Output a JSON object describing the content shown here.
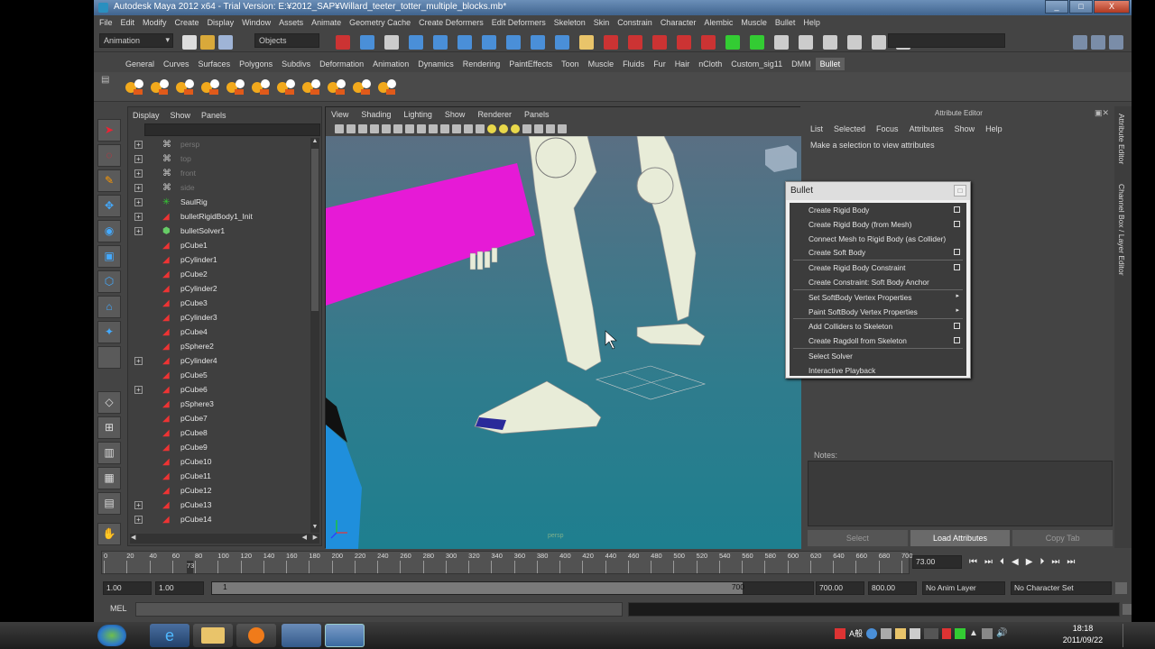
{
  "window": {
    "title": "Autodesk Maya 2012 x64 - Trial Version: E:¥2012_SAP¥Willard_teeter_totter_multiple_blocks.mb*",
    "controls": [
      "_",
      "□",
      "X"
    ]
  },
  "menubar": [
    "File",
    "Edit",
    "Modify",
    "Create",
    "Display",
    "Window",
    "Assets",
    "Animate",
    "Geometry Cache",
    "Create Deformers",
    "Edit Deformers",
    "Skeleton",
    "Skin",
    "Constrain",
    "Character",
    "Alembic",
    "Muscle",
    "Bullet",
    "Help"
  ],
  "statusline": {
    "mode": "Animation",
    "selection_mask": "Objects"
  },
  "shelf_tabs": [
    "General",
    "Curves",
    "Surfaces",
    "Polygons",
    "Subdivs",
    "Deformation",
    "Animation",
    "Dynamics",
    "Rendering",
    "PaintEffects",
    "Toon",
    "Muscle",
    "Fluids",
    "Fur",
    "Hair",
    "nCloth",
    "Custom_sig11",
    "DMM",
    "Bullet"
  ],
  "shelf_active": "Bullet",
  "outliner": {
    "menu": [
      "Display",
      "Show",
      "Panels"
    ],
    "items": [
      {
        "name": "persp",
        "icon": "camera-icon",
        "expand": true,
        "dim": true
      },
      {
        "name": "top",
        "icon": "camera-icon",
        "expand": true,
        "dim": true
      },
      {
        "name": "front",
        "icon": "camera-icon",
        "expand": true,
        "dim": true
      },
      {
        "name": "side",
        "icon": "camera-icon",
        "expand": true,
        "dim": true
      },
      {
        "name": "SaulRig",
        "icon": "joint-icon",
        "expand": true,
        "dim": false
      },
      {
        "name": "bulletRigidBody1_Init",
        "icon": "mesh-icon",
        "expand": true,
        "dim": false
      },
      {
        "name": "bulletSolver1",
        "icon": "solver-icon",
        "expand": true,
        "dim": false
      },
      {
        "name": "pCube1",
        "icon": "mesh-icon",
        "expand": false,
        "dim": false
      },
      {
        "name": "pCylinder1",
        "icon": "mesh-icon",
        "expand": false,
        "dim": false
      },
      {
        "name": "pCube2",
        "icon": "mesh-icon",
        "expand": false,
        "dim": false
      },
      {
        "name": "pCylinder2",
        "icon": "mesh-icon",
        "expand": false,
        "dim": false
      },
      {
        "name": "pCube3",
        "icon": "mesh-icon",
        "expand": false,
        "dim": false
      },
      {
        "name": "pCylinder3",
        "icon": "mesh-icon",
        "expand": false,
        "dim": false
      },
      {
        "name": "pCube4",
        "icon": "mesh-icon",
        "expand": false,
        "dim": false
      },
      {
        "name": "pSphere2",
        "icon": "mesh-icon",
        "expand": false,
        "dim": false
      },
      {
        "name": "pCylinder4",
        "icon": "mesh-icon",
        "expand": true,
        "dim": false
      },
      {
        "name": "pCube5",
        "icon": "mesh-icon",
        "expand": false,
        "dim": false
      },
      {
        "name": "pCube6",
        "icon": "mesh-icon",
        "expand": true,
        "dim": false
      },
      {
        "name": "pSphere3",
        "icon": "mesh-icon",
        "expand": false,
        "dim": false
      },
      {
        "name": "pCube7",
        "icon": "mesh-icon",
        "expand": false,
        "dim": false
      },
      {
        "name": "pCube8",
        "icon": "mesh-icon",
        "expand": false,
        "dim": false
      },
      {
        "name": "pCube9",
        "icon": "mesh-icon",
        "expand": false,
        "dim": false
      },
      {
        "name": "pCube10",
        "icon": "mesh-icon",
        "expand": false,
        "dim": false
      },
      {
        "name": "pCube11",
        "icon": "mesh-icon",
        "expand": false,
        "dim": false
      },
      {
        "name": "pCube12",
        "icon": "mesh-icon",
        "expand": false,
        "dim": false
      },
      {
        "name": "pCube13",
        "icon": "mesh-icon",
        "expand": true,
        "dim": false
      },
      {
        "name": "pCube14",
        "icon": "mesh-icon",
        "expand": true,
        "dim": false
      }
    ]
  },
  "viewport": {
    "menu": [
      "View",
      "Shading",
      "Lighting",
      "Show",
      "Renderer",
      "Panels"
    ],
    "camera_label": "persp",
    "colors": {
      "pink_block": "#e61ad6",
      "blue_block": "#1f8fdc"
    }
  },
  "attribute_editor": {
    "header": "Attribute Editor",
    "menu": [
      "List",
      "Selected",
      "Focus",
      "Attributes",
      "Show",
      "Help"
    ],
    "hint": "Make a selection to view attributes",
    "notes_label": "Notes:",
    "buttons": [
      "Select",
      "Load Attributes",
      "Copy Tab"
    ]
  },
  "side_tabs": [
    "Attribute Editor",
    "Channel Box / Layer Editor"
  ],
  "bullet_menu": {
    "title": "Bullet",
    "items": [
      {
        "label": "Create Rigid Body",
        "option": true,
        "submenu": false,
        "sep_before": false
      },
      {
        "label": "Create Rigid Body (from Mesh)",
        "option": true,
        "submenu": false,
        "sep_before": false
      },
      {
        "label": "Connect Mesh to Rigid Body (as Collider)",
        "option": false,
        "submenu": false,
        "sep_before": false
      },
      {
        "label": "Create Soft Body",
        "option": true,
        "submenu": false,
        "sep_before": false
      },
      {
        "label": "Create Rigid Body Constraint",
        "option": true,
        "submenu": false,
        "sep_before": true
      },
      {
        "label": "Create Constraint: Soft Body Anchor",
        "option": false,
        "submenu": false,
        "sep_before": false
      },
      {
        "label": "Set SoftBody Vertex Properties",
        "option": false,
        "submenu": true,
        "sep_before": true
      },
      {
        "label": "Paint SoftBody Vertex Properties",
        "option": false,
        "submenu": true,
        "sep_before": false
      },
      {
        "label": "Add Colliders to Skeleton",
        "option": true,
        "submenu": false,
        "sep_before": true
      },
      {
        "label": "Create Ragdoll from Skeleton",
        "option": true,
        "submenu": false,
        "sep_before": false
      },
      {
        "label": "Select Solver",
        "option": false,
        "submenu": false,
        "sep_before": true
      },
      {
        "label": "Interactive Playback",
        "option": false,
        "submenu": false,
        "sep_before": false
      }
    ]
  },
  "timeline": {
    "ticks": [
      "0",
      "20",
      "40",
      "60",
      "80",
      "100",
      "120",
      "140",
      "160",
      "180",
      "200",
      "220",
      "240",
      "260",
      "280",
      "300",
      "320",
      "340",
      "360",
      "380",
      "400",
      "420",
      "440",
      "460",
      "480",
      "500",
      "520",
      "540",
      "560",
      "580",
      "600",
      "620",
      "640",
      "660",
      "680",
      "700"
    ],
    "current_frame": "73",
    "current_time_field": "73.00",
    "current_fraction": 0.104
  },
  "range": {
    "start": "1.00",
    "playback_start": "1.00",
    "slider_start": "1",
    "slider_end": "700",
    "playback_end": "700.00",
    "end": "800.00",
    "anim_layer": "No Anim Layer",
    "character_set": "No Character Set"
  },
  "command_line": {
    "label": "MEL"
  },
  "taskbar": {
    "time": "18:18",
    "date": "2011/09/22",
    "tray_text": "A般"
  }
}
